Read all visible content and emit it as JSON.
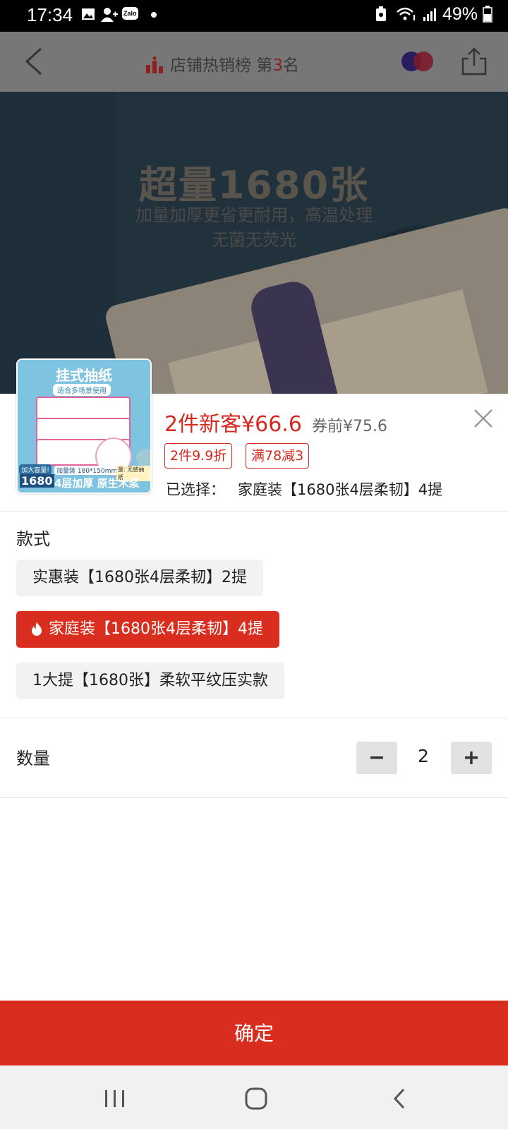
{
  "status_bar": {
    "time": "17:34",
    "zalo_label": "Zalo",
    "battery": "49%",
    "icons": [
      "image-icon",
      "add-contact-icon",
      "zalo-icon",
      "dot-icon",
      "battery-saver-icon",
      "wifi-icon",
      "signal-icon",
      "battery-icon"
    ]
  },
  "top_nav": {
    "rank_prefix": "店铺热销榜 第",
    "rank_number": "3",
    "rank_suffix": "名"
  },
  "hero": {
    "title": "超量1680张",
    "subtitle_1": "加量加厚更省更耐用，高温处理",
    "subtitle_2": "无菌无荧光"
  },
  "product_thumb": {
    "title": "挂式抽纸",
    "subtitle": "适合多场景使用",
    "badge": "加大容量!",
    "count": "1680",
    "size": "加量装 180*150mm",
    "corner": "量: 无感抽纸",
    "bottom": "4层加厚 原生木浆"
  },
  "price": {
    "lead": "2件新客¥66.6",
    "before_coupon": "券前¥75.6"
  },
  "tags": [
    "2件9.9折",
    "满78减3"
  ],
  "selected": {
    "label": "已选择：",
    "value": "家庭装【1680张4层柔韧】4提"
  },
  "style_section": {
    "label": "款式",
    "options": [
      "实惠装【1680张4层柔韧】2提",
      "家庭装【1680张4层柔韧】4提",
      "1大提【1680张】柔软平纹压实款"
    ],
    "selected_index": 1
  },
  "quantity": {
    "label": "数量",
    "value": "2",
    "minus": "−",
    "plus": "+"
  },
  "confirm_label": "确定",
  "colors": {
    "accent": "#d92d20",
    "price_red": "#d5291f",
    "option_bg": "#f2f2f2",
    "stepper_bg": "#e2e2e2"
  }
}
